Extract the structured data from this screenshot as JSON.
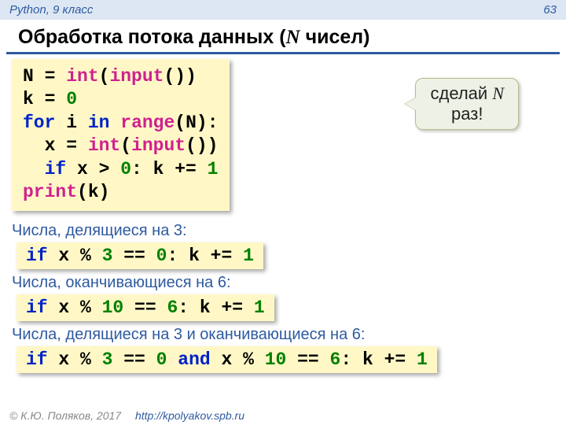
{
  "header": {
    "left": "Python, 9 класс",
    "page": "63"
  },
  "title": {
    "pre": "Обработка потока данных (",
    "N": "N",
    "post": " чисел)"
  },
  "code_main": {
    "l1": {
      "a": "N = ",
      "fn1": "int",
      "b": "(",
      "fn2": "input",
      "c": "())"
    },
    "l2": {
      "a": "k = ",
      "num": "0"
    },
    "l3": {
      "kw1": "for",
      "a": " i ",
      "kw2": "in",
      "b": " ",
      "fn": "range",
      "c": "(N):"
    },
    "l4": {
      "a": "  x = ",
      "fn1": "int",
      "b": "(",
      "fn2": "input",
      "c": "())"
    },
    "l5": {
      "a": "  ",
      "kw": "if",
      "b": " x > ",
      "num1": "0",
      "c": ": k += ",
      "num2": "1"
    },
    "l6": {
      "fn": "print",
      "a": "(k)"
    }
  },
  "callout": {
    "line1": "сделай ",
    "N": "N",
    "line2": "раз!"
  },
  "caption1": "Числа, делящиеся на 3:",
  "block1": {
    "kw": "if",
    "a": " x % ",
    "n1": "3",
    "b": " == ",
    "n2": "0",
    "c": ": k += ",
    "n3": "1"
  },
  "caption2": "Числа, оканчивающиеся на 6:",
  "block2": {
    "kw": "if",
    "a": " x % ",
    "n1": "10",
    "b": " == ",
    "n2": "6",
    "c": ": k += ",
    "n3": "1"
  },
  "caption3": "Числа, делящиеся на 3 и оканчивающиеся на 6:",
  "block3": {
    "kw1": "if",
    "a": " x % ",
    "n1": "3",
    "b": " == ",
    "n2": "0",
    "c": " ",
    "kw2": "and",
    "d": " x % ",
    "n3": "10",
    "e": " == ",
    "n4": "6",
    "f": ": k += ",
    "n5": "1"
  },
  "footer": {
    "copy": "© К.Ю. Поляков, 2017",
    "url": "http://kpolyakov.spb.ru"
  }
}
